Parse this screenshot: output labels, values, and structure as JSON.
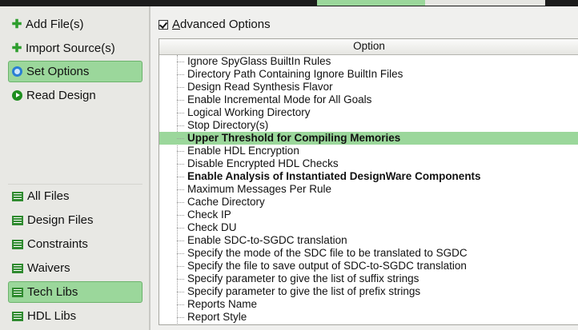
{
  "sidebar": {
    "actions": [
      {
        "label": "Add File(s)",
        "icon": "plus-icon"
      },
      {
        "label": "Import Source(s)",
        "icon": "plus-icon"
      },
      {
        "label": "Set Options",
        "icon": "settings-circle-icon",
        "active": true
      },
      {
        "label": "Read Design",
        "icon": "play-circle-icon"
      }
    ],
    "views": [
      {
        "label": "All Files",
        "icon": "list-icon"
      },
      {
        "label": "Design Files",
        "icon": "list-icon"
      },
      {
        "label": "Constraints",
        "icon": "list-icon"
      },
      {
        "label": "Waivers",
        "icon": "list-icon"
      },
      {
        "label": "Tech Libs",
        "icon": "list-icon",
        "active": true
      },
      {
        "label": "HDL Libs",
        "icon": "list-icon"
      }
    ]
  },
  "main": {
    "advanced_options": {
      "label_first": "A",
      "label_rest": "dvanced Options",
      "checked": true
    },
    "table": {
      "header": "Option",
      "rows": [
        {
          "text": "Ignore SpyGlass BuiltIn Rules"
        },
        {
          "text": "Directory Path Containing Ignore BuiltIn Files"
        },
        {
          "text": "Design Read Synthesis Flavor"
        },
        {
          "text": "Enable Incremental Mode for All Goals"
        },
        {
          "text": "Logical Working Directory"
        },
        {
          "text": "Stop Directory(s)"
        },
        {
          "text": "Upper Threshold for Compiling Memories",
          "bold": true,
          "selected": true
        },
        {
          "text": "Enable HDL Encryption"
        },
        {
          "text": "Disable Encrypted HDL Checks"
        },
        {
          "text": "Enable Analysis of Instantiated DesignWare Components",
          "bold": true
        },
        {
          "text": "Maximum Messages Per Rule"
        },
        {
          "text": "Cache Directory"
        },
        {
          "text": "Check IP"
        },
        {
          "text": "Check DU"
        },
        {
          "text": "Enable SDC-to-SGDC translation"
        },
        {
          "text": "Specify the mode of the SDC file to be translated to SGDC"
        },
        {
          "text": "Specify the file to save output of SDC-to-SGDC translation"
        },
        {
          "text": "Specify parameter to give the list of suffix strings"
        },
        {
          "text": "Specify parameter to give the list of prefix strings"
        },
        {
          "text": "Reports Name"
        },
        {
          "text": "Report Style"
        }
      ]
    }
  },
  "colors": {
    "selection": "#9bd79b",
    "accent_green": "#2f8a2f"
  }
}
